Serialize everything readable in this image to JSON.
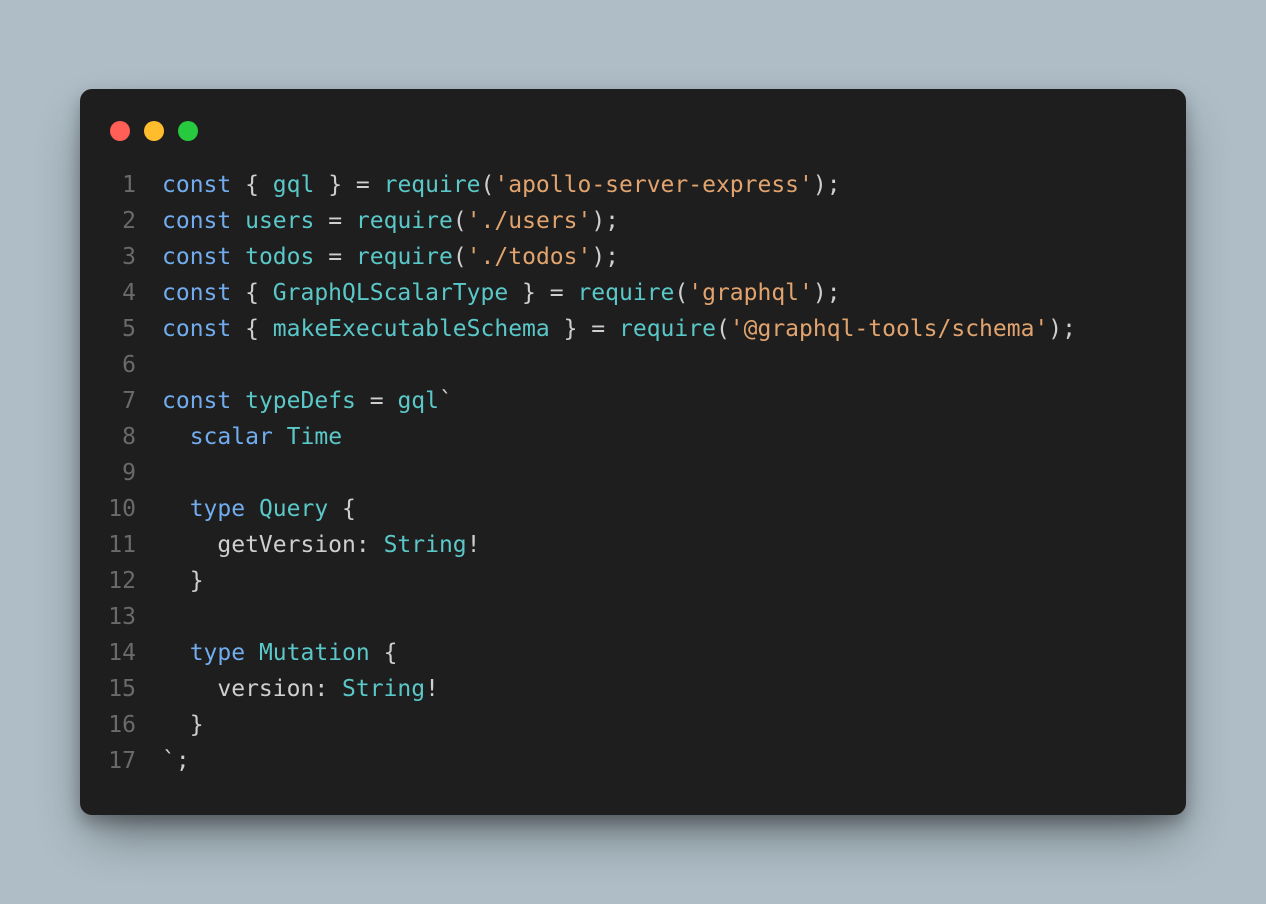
{
  "colors": {
    "bg_page": "#aebdc6",
    "bg_editor": "#1f1e1e",
    "red": "#ff5f56",
    "yellow": "#ffbd2e",
    "green": "#27c93f",
    "line_number": "#6a6a6a",
    "keyword": "#71adee",
    "identifier": "#cfcfcf",
    "teal": "#5ac8c8",
    "string": "#e2a46e"
  },
  "lines": [
    {
      "n": "1",
      "tokens": [
        {
          "c": "kw",
          "t": "const"
        },
        {
          "c": "id",
          "t": " { "
        },
        {
          "c": "fn",
          "t": "gql"
        },
        {
          "c": "id",
          "t": " } = "
        },
        {
          "c": "fn",
          "t": "require"
        },
        {
          "c": "id",
          "t": "("
        },
        {
          "c": "str",
          "t": "'apollo-server-express'"
        },
        {
          "c": "id",
          "t": ");"
        }
      ]
    },
    {
      "n": "2",
      "tokens": [
        {
          "c": "kw",
          "t": "const"
        },
        {
          "c": "id",
          "t": " "
        },
        {
          "c": "fn",
          "t": "users"
        },
        {
          "c": "id",
          "t": " = "
        },
        {
          "c": "fn",
          "t": "require"
        },
        {
          "c": "id",
          "t": "("
        },
        {
          "c": "str",
          "t": "'./users'"
        },
        {
          "c": "id",
          "t": ");"
        }
      ]
    },
    {
      "n": "3",
      "tokens": [
        {
          "c": "kw",
          "t": "const"
        },
        {
          "c": "id",
          "t": " "
        },
        {
          "c": "fn",
          "t": "todos"
        },
        {
          "c": "id",
          "t": " = "
        },
        {
          "c": "fn",
          "t": "require"
        },
        {
          "c": "id",
          "t": "("
        },
        {
          "c": "str",
          "t": "'./todos'"
        },
        {
          "c": "id",
          "t": ");"
        }
      ]
    },
    {
      "n": "4",
      "tokens": [
        {
          "c": "kw",
          "t": "const"
        },
        {
          "c": "id",
          "t": " { "
        },
        {
          "c": "fn",
          "t": "GraphQLScalarType"
        },
        {
          "c": "id",
          "t": " } = "
        },
        {
          "c": "fn",
          "t": "require"
        },
        {
          "c": "id",
          "t": "("
        },
        {
          "c": "str",
          "t": "'graphql'"
        },
        {
          "c": "id",
          "t": ");"
        }
      ]
    },
    {
      "n": "5",
      "tokens": [
        {
          "c": "kw",
          "t": "const"
        },
        {
          "c": "id",
          "t": " { "
        },
        {
          "c": "fn",
          "t": "makeExecutableSchema"
        },
        {
          "c": "id",
          "t": " } = "
        },
        {
          "c": "fn",
          "t": "require"
        },
        {
          "c": "id",
          "t": "("
        },
        {
          "c": "str",
          "t": "'@graphql-tools/schema'"
        },
        {
          "c": "id",
          "t": ");"
        }
      ]
    },
    {
      "n": "6",
      "tokens": [
        {
          "c": "id",
          "t": ""
        }
      ]
    },
    {
      "n": "7",
      "tokens": [
        {
          "c": "kw",
          "t": "const"
        },
        {
          "c": "id",
          "t": " "
        },
        {
          "c": "fn",
          "t": "typeDefs"
        },
        {
          "c": "id",
          "t": " = "
        },
        {
          "c": "fn",
          "t": "gql"
        },
        {
          "c": "id",
          "t": "`"
        }
      ]
    },
    {
      "n": "8",
      "tokens": [
        {
          "c": "id",
          "t": "  "
        },
        {
          "c": "kw",
          "t": "scalar"
        },
        {
          "c": "id",
          "t": " "
        },
        {
          "c": "fn",
          "t": "Time"
        }
      ]
    },
    {
      "n": "9",
      "tokens": [
        {
          "c": "id",
          "t": ""
        }
      ]
    },
    {
      "n": "10",
      "tokens": [
        {
          "c": "id",
          "t": "  "
        },
        {
          "c": "kw",
          "t": "type"
        },
        {
          "c": "id",
          "t": " "
        },
        {
          "c": "fn",
          "t": "Query"
        },
        {
          "c": "id",
          "t": " {"
        }
      ]
    },
    {
      "n": "11",
      "tokens": [
        {
          "c": "id",
          "t": "    getVersion: "
        },
        {
          "c": "fn",
          "t": "String"
        },
        {
          "c": "id",
          "t": "!"
        }
      ]
    },
    {
      "n": "12",
      "tokens": [
        {
          "c": "id",
          "t": "  }"
        }
      ]
    },
    {
      "n": "13",
      "tokens": [
        {
          "c": "id",
          "t": ""
        }
      ]
    },
    {
      "n": "14",
      "tokens": [
        {
          "c": "id",
          "t": "  "
        },
        {
          "c": "kw",
          "t": "type"
        },
        {
          "c": "id",
          "t": " "
        },
        {
          "c": "fn",
          "t": "Mutation"
        },
        {
          "c": "id",
          "t": " {"
        }
      ]
    },
    {
      "n": "15",
      "tokens": [
        {
          "c": "id",
          "t": "    version: "
        },
        {
          "c": "fn",
          "t": "String"
        },
        {
          "c": "id",
          "t": "!"
        }
      ]
    },
    {
      "n": "16",
      "tokens": [
        {
          "c": "id",
          "t": "  }"
        }
      ]
    },
    {
      "n": "17",
      "tokens": [
        {
          "c": "id",
          "t": "`;"
        }
      ]
    }
  ]
}
